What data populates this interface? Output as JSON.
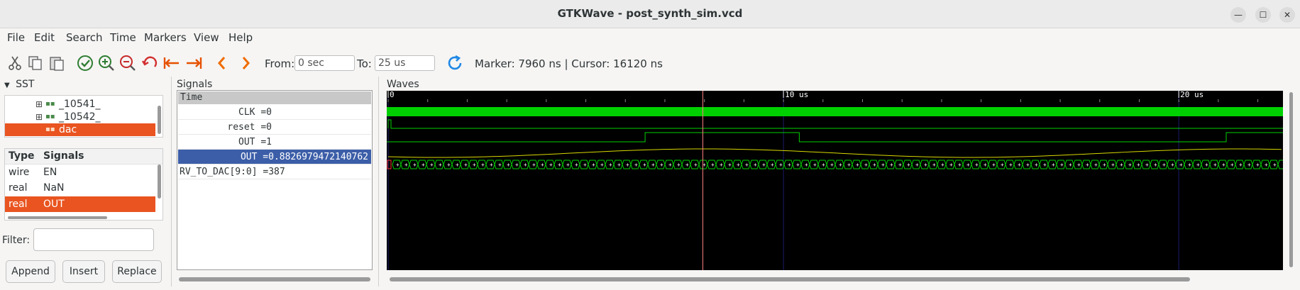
{
  "window": {
    "title": "GTKWave - post_synth_sim.vcd",
    "minimize": "—",
    "maximize": "☐",
    "close": "✕"
  },
  "menu": [
    "File",
    "Edit",
    "Search",
    "Time",
    "Markers",
    "View",
    "Help"
  ],
  "toolbar": {
    "icons": [
      "cut-icon",
      "copy-icon",
      "paste-icon",
      "zoom-fit-icon",
      "zoom-in-icon",
      "zoom-out-icon",
      "undo-zoom-icon",
      "zoom-start-icon",
      "zoom-end-icon",
      "prev-page-icon",
      "next-page-icon",
      "reload-icon"
    ],
    "from_label": "From:",
    "from_value": "0 sec",
    "to_label": "To:",
    "to_value": "25 us",
    "marker_text": "Marker: 7960 ns  |  Cursor: 16120 ns"
  },
  "sst": {
    "title": "SST",
    "tree": [
      {
        "label": "_10541_",
        "selected": false
      },
      {
        "label": "_10542_",
        "selected": false
      },
      {
        "label": "dac",
        "selected": true
      }
    ],
    "table_headers": {
      "type": "Type",
      "signals": "Signals"
    },
    "rows": [
      {
        "type": "wire",
        "name": "EN",
        "selected": false
      },
      {
        "type": "real",
        "name": "NaN",
        "selected": false
      },
      {
        "type": "real",
        "name": "OUT",
        "selected": true
      }
    ],
    "filter_label": "Filter:",
    "filter_value": "",
    "buttons": {
      "append": "Append",
      "insert": "Insert",
      "replace": "Replace"
    }
  },
  "signals": {
    "title": "Signals",
    "time_header": "Time",
    "rows": [
      {
        "text": "CLK =0",
        "selected": false
      },
      {
        "text": "reset =0",
        "selected": false
      },
      {
        "text": "OUT =1",
        "selected": false
      },
      {
        "text": "OUT =0.8826979472140762",
        "selected": true
      },
      {
        "text": "RV_TO_DAC[9:0] =387",
        "selected": false
      }
    ]
  },
  "waves": {
    "title": "Waves",
    "time_ticks": [
      {
        "label": "0",
        "time_us": 0
      },
      {
        "label": "10 us",
        "time_us": 10
      },
      {
        "label": "20 us",
        "time_us": 20
      }
    ],
    "view_range_us": [
      0,
      22.6
    ],
    "marker_ns": 7960,
    "cursor_ns": 16120,
    "colors": {
      "clock": "#00d000",
      "signal": "#00d000",
      "analog": "#d8d800",
      "marker": "#ff8080",
      "grid": "#1c1c6c",
      "bus_bad": "#ff3030",
      "text": "#ffffff"
    }
  }
}
